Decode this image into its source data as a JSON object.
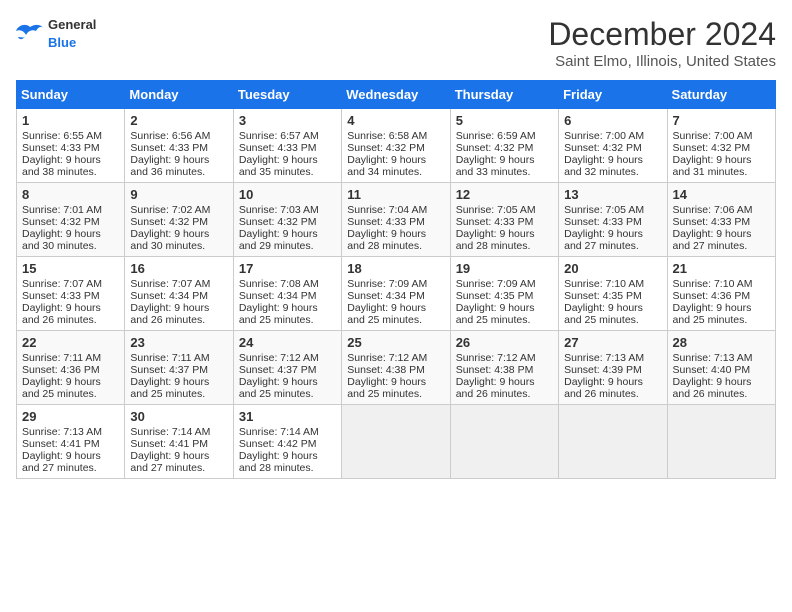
{
  "header": {
    "logo_general": "General",
    "logo_blue": "Blue",
    "month": "December 2024",
    "location": "Saint Elmo, Illinois, United States"
  },
  "weekdays": [
    "Sunday",
    "Monday",
    "Tuesday",
    "Wednesday",
    "Thursday",
    "Friday",
    "Saturday"
  ],
  "weeks": [
    [
      {
        "day": "1",
        "sunrise": "Sunrise: 6:55 AM",
        "sunset": "Sunset: 4:33 PM",
        "daylight": "Daylight: 9 hours and 38 minutes."
      },
      {
        "day": "2",
        "sunrise": "Sunrise: 6:56 AM",
        "sunset": "Sunset: 4:33 PM",
        "daylight": "Daylight: 9 hours and 36 minutes."
      },
      {
        "day": "3",
        "sunrise": "Sunrise: 6:57 AM",
        "sunset": "Sunset: 4:33 PM",
        "daylight": "Daylight: 9 hours and 35 minutes."
      },
      {
        "day": "4",
        "sunrise": "Sunrise: 6:58 AM",
        "sunset": "Sunset: 4:32 PM",
        "daylight": "Daylight: 9 hours and 34 minutes."
      },
      {
        "day": "5",
        "sunrise": "Sunrise: 6:59 AM",
        "sunset": "Sunset: 4:32 PM",
        "daylight": "Daylight: 9 hours and 33 minutes."
      },
      {
        "day": "6",
        "sunrise": "Sunrise: 7:00 AM",
        "sunset": "Sunset: 4:32 PM",
        "daylight": "Daylight: 9 hours and 32 minutes."
      },
      {
        "day": "7",
        "sunrise": "Sunrise: 7:00 AM",
        "sunset": "Sunset: 4:32 PM",
        "daylight": "Daylight: 9 hours and 31 minutes."
      }
    ],
    [
      {
        "day": "8",
        "sunrise": "Sunrise: 7:01 AM",
        "sunset": "Sunset: 4:32 PM",
        "daylight": "Daylight: 9 hours and 30 minutes."
      },
      {
        "day": "9",
        "sunrise": "Sunrise: 7:02 AM",
        "sunset": "Sunset: 4:32 PM",
        "daylight": "Daylight: 9 hours and 30 minutes."
      },
      {
        "day": "10",
        "sunrise": "Sunrise: 7:03 AM",
        "sunset": "Sunset: 4:32 PM",
        "daylight": "Daylight: 9 hours and 29 minutes."
      },
      {
        "day": "11",
        "sunrise": "Sunrise: 7:04 AM",
        "sunset": "Sunset: 4:33 PM",
        "daylight": "Daylight: 9 hours and 28 minutes."
      },
      {
        "day": "12",
        "sunrise": "Sunrise: 7:05 AM",
        "sunset": "Sunset: 4:33 PM",
        "daylight": "Daylight: 9 hours and 28 minutes."
      },
      {
        "day": "13",
        "sunrise": "Sunrise: 7:05 AM",
        "sunset": "Sunset: 4:33 PM",
        "daylight": "Daylight: 9 hours and 27 minutes."
      },
      {
        "day": "14",
        "sunrise": "Sunrise: 7:06 AM",
        "sunset": "Sunset: 4:33 PM",
        "daylight": "Daylight: 9 hours and 27 minutes."
      }
    ],
    [
      {
        "day": "15",
        "sunrise": "Sunrise: 7:07 AM",
        "sunset": "Sunset: 4:33 PM",
        "daylight": "Daylight: 9 hours and 26 minutes."
      },
      {
        "day": "16",
        "sunrise": "Sunrise: 7:07 AM",
        "sunset": "Sunset: 4:34 PM",
        "daylight": "Daylight: 9 hours and 26 minutes."
      },
      {
        "day": "17",
        "sunrise": "Sunrise: 7:08 AM",
        "sunset": "Sunset: 4:34 PM",
        "daylight": "Daylight: 9 hours and 25 minutes."
      },
      {
        "day": "18",
        "sunrise": "Sunrise: 7:09 AM",
        "sunset": "Sunset: 4:34 PM",
        "daylight": "Daylight: 9 hours and 25 minutes."
      },
      {
        "day": "19",
        "sunrise": "Sunrise: 7:09 AM",
        "sunset": "Sunset: 4:35 PM",
        "daylight": "Daylight: 9 hours and 25 minutes."
      },
      {
        "day": "20",
        "sunrise": "Sunrise: 7:10 AM",
        "sunset": "Sunset: 4:35 PM",
        "daylight": "Daylight: 9 hours and 25 minutes."
      },
      {
        "day": "21",
        "sunrise": "Sunrise: 7:10 AM",
        "sunset": "Sunset: 4:36 PM",
        "daylight": "Daylight: 9 hours and 25 minutes."
      }
    ],
    [
      {
        "day": "22",
        "sunrise": "Sunrise: 7:11 AM",
        "sunset": "Sunset: 4:36 PM",
        "daylight": "Daylight: 9 hours and 25 minutes."
      },
      {
        "day": "23",
        "sunrise": "Sunrise: 7:11 AM",
        "sunset": "Sunset: 4:37 PM",
        "daylight": "Daylight: 9 hours and 25 minutes."
      },
      {
        "day": "24",
        "sunrise": "Sunrise: 7:12 AM",
        "sunset": "Sunset: 4:37 PM",
        "daylight": "Daylight: 9 hours and 25 minutes."
      },
      {
        "day": "25",
        "sunrise": "Sunrise: 7:12 AM",
        "sunset": "Sunset: 4:38 PM",
        "daylight": "Daylight: 9 hours and 25 minutes."
      },
      {
        "day": "26",
        "sunrise": "Sunrise: 7:12 AM",
        "sunset": "Sunset: 4:38 PM",
        "daylight": "Daylight: 9 hours and 26 minutes."
      },
      {
        "day": "27",
        "sunrise": "Sunrise: 7:13 AM",
        "sunset": "Sunset: 4:39 PM",
        "daylight": "Daylight: 9 hours and 26 minutes."
      },
      {
        "day": "28",
        "sunrise": "Sunrise: 7:13 AM",
        "sunset": "Sunset: 4:40 PM",
        "daylight": "Daylight: 9 hours and 26 minutes."
      }
    ],
    [
      {
        "day": "29",
        "sunrise": "Sunrise: 7:13 AM",
        "sunset": "Sunset: 4:41 PM",
        "daylight": "Daylight: 9 hours and 27 minutes."
      },
      {
        "day": "30",
        "sunrise": "Sunrise: 7:14 AM",
        "sunset": "Sunset: 4:41 PM",
        "daylight": "Daylight: 9 hours and 27 minutes."
      },
      {
        "day": "31",
        "sunrise": "Sunrise: 7:14 AM",
        "sunset": "Sunset: 4:42 PM",
        "daylight": "Daylight: 9 hours and 28 minutes."
      },
      null,
      null,
      null,
      null
    ]
  ]
}
